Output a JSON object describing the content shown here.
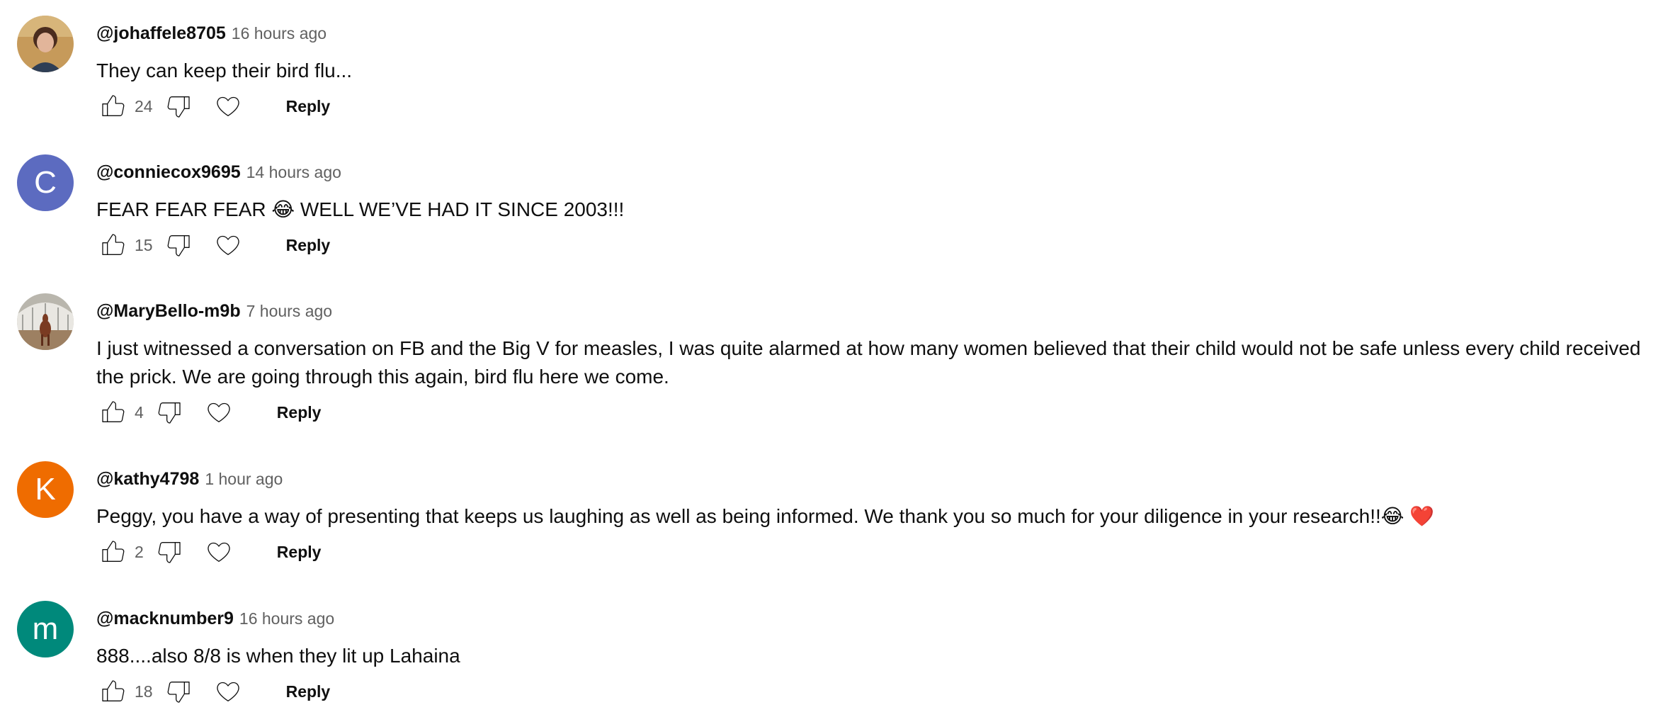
{
  "comments": [
    {
      "author": "@johaffele8705",
      "time": "16 hours ago",
      "text": "They can keep their bird flu...",
      "likes": "24",
      "reply_label": "Reply",
      "avatar": {
        "type": "photo",
        "subject": "woman-portrait"
      }
    },
    {
      "author": "@conniecox9695",
      "time": "14 hours ago",
      "text": "FEAR FEAR FEAR 😂  WELL WE’VE HAD IT SINCE 2003!!!",
      "likes": "15",
      "reply_label": "Reply",
      "avatar": {
        "type": "letter",
        "letter": "C",
        "color": "#5c6bc0"
      }
    },
    {
      "author": "@MaryBello-m9b",
      "time": "7 hours ago",
      "text": "I just witnessed a conversation on FB and the Big V for measles, I was quite alarmed at how many women believed that their child would not be safe unless every child received the prick. We are going through this again, bird flu here we come.",
      "likes": "4",
      "reply_label": "Reply",
      "avatar": {
        "type": "photo",
        "subject": "horse-in-arena"
      }
    },
    {
      "author": "@kathy4798",
      "time": "1 hour ago",
      "text": "Peggy, you have a way of presenting that keeps us laughing as well as being informed. We thank you so much for your diligence  in your research!!😂 ❤️",
      "likes": "2",
      "reply_label": "Reply",
      "avatar": {
        "type": "letter",
        "letter": "K",
        "color": "#ef6c00"
      }
    },
    {
      "author": "@macknumber9",
      "time": "16 hours ago",
      "text": "888....also 8/8 is when they lit up Lahaina",
      "likes": "18",
      "reply_label": "Reply",
      "avatar": {
        "type": "letter",
        "letter": "m",
        "color": "#00897b"
      }
    }
  ],
  "icons": {
    "like": "thumb-up-icon",
    "dislike": "thumb-down-icon",
    "heart": "heart-icon"
  }
}
